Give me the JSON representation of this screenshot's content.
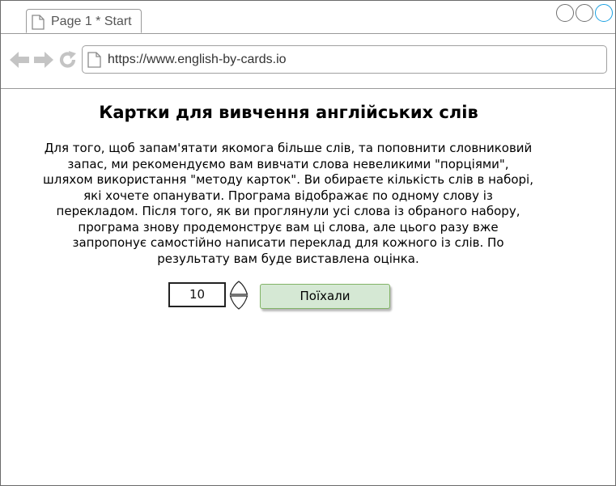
{
  "browser": {
    "tab": {
      "label": "Page 1 * Start",
      "icon": "document-icon"
    },
    "window_controls": [
      "minimize",
      "restore",
      "maximize"
    ],
    "nav": {
      "back_icon": "back-arrow-icon",
      "forward_icon": "forward-arrow-icon",
      "reload_icon": "reload-icon"
    },
    "address": {
      "icon": "document-icon",
      "url": "https://www.english-by-cards.io"
    },
    "accent_color": "#1ba1e2"
  },
  "page": {
    "title": "Картки для вивчення англійських слів",
    "description": "Для того, щоб запам'ятати якомога більше слів, та поповнити словниковий запас, ми рекомендуємо вам вивчати слова невеликими \"порціями\", шляхом використання \"методу карток\". Ви обираєте кількість слів в наборі, які хочете опанувати. Програма відображає по одному слову із перекладом. Після того, як ви проглянули усі слова із обраного набору, програма знову продемонструє вам ці слова, але цього разу вже запропонує самостійно написати переклад для кожного із слів. По результату вам буде виставлена оцінка.",
    "word_count": "10",
    "stepper_icons": [
      "chevron-up-icon",
      "chevron-down-icon"
    ],
    "start_button": {
      "label": "Поїхали",
      "color": "#d5e8d4",
      "border_color": "#82b366"
    }
  }
}
